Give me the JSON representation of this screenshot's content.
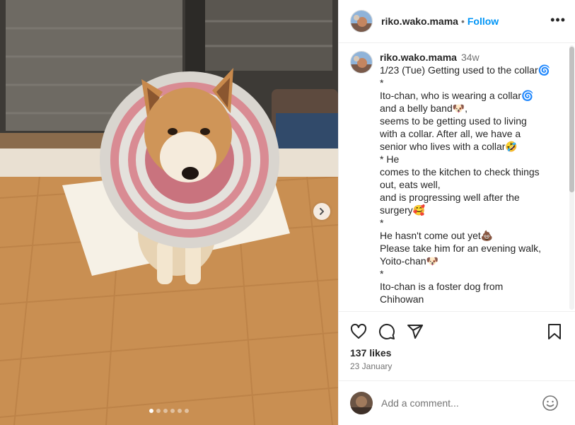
{
  "post": {
    "username": "riko.wako.mama",
    "follow_label": "Follow",
    "separator": "•",
    "more_label": "•••",
    "caption": {
      "age": "34w",
      "lines": [
        "1/23 (Tue) Getting used to the collar🌀",
        "*",
        "Ito-chan, who is wearing a collar🌀",
        "and a belly band🐶,",
        "seems to be getting used to living",
        "with a collar. After all, we have a",
        "senior who lives with a collar🤣",
        "* He",
        "comes to the kitchen to check things",
        "out, eats well,",
        "and is progressing well after the",
        "surgery🥰",
        "*",
        "He hasn't come out yet💩",
        "Please take him for an evening walk,",
        "Yoito-chan🐶",
        "*",
        "Ito-chan is a foster dog from",
        "Chihowan"
      ]
    },
    "likes": "137 likes",
    "date": "23 January",
    "comment_placeholder": "Add a comment...",
    "carousel": {
      "slides": 6,
      "active_index": 0
    }
  },
  "icons": {
    "like": "heart-icon",
    "comment": "comment-bubble-icon",
    "share": "paper-plane-icon",
    "save": "bookmark-icon",
    "next": "chevron-right-icon",
    "emoji": "smiley-icon"
  },
  "colors": {
    "accent": "#0095f6",
    "secondary_text": "#737373",
    "divider": "#efefef"
  }
}
